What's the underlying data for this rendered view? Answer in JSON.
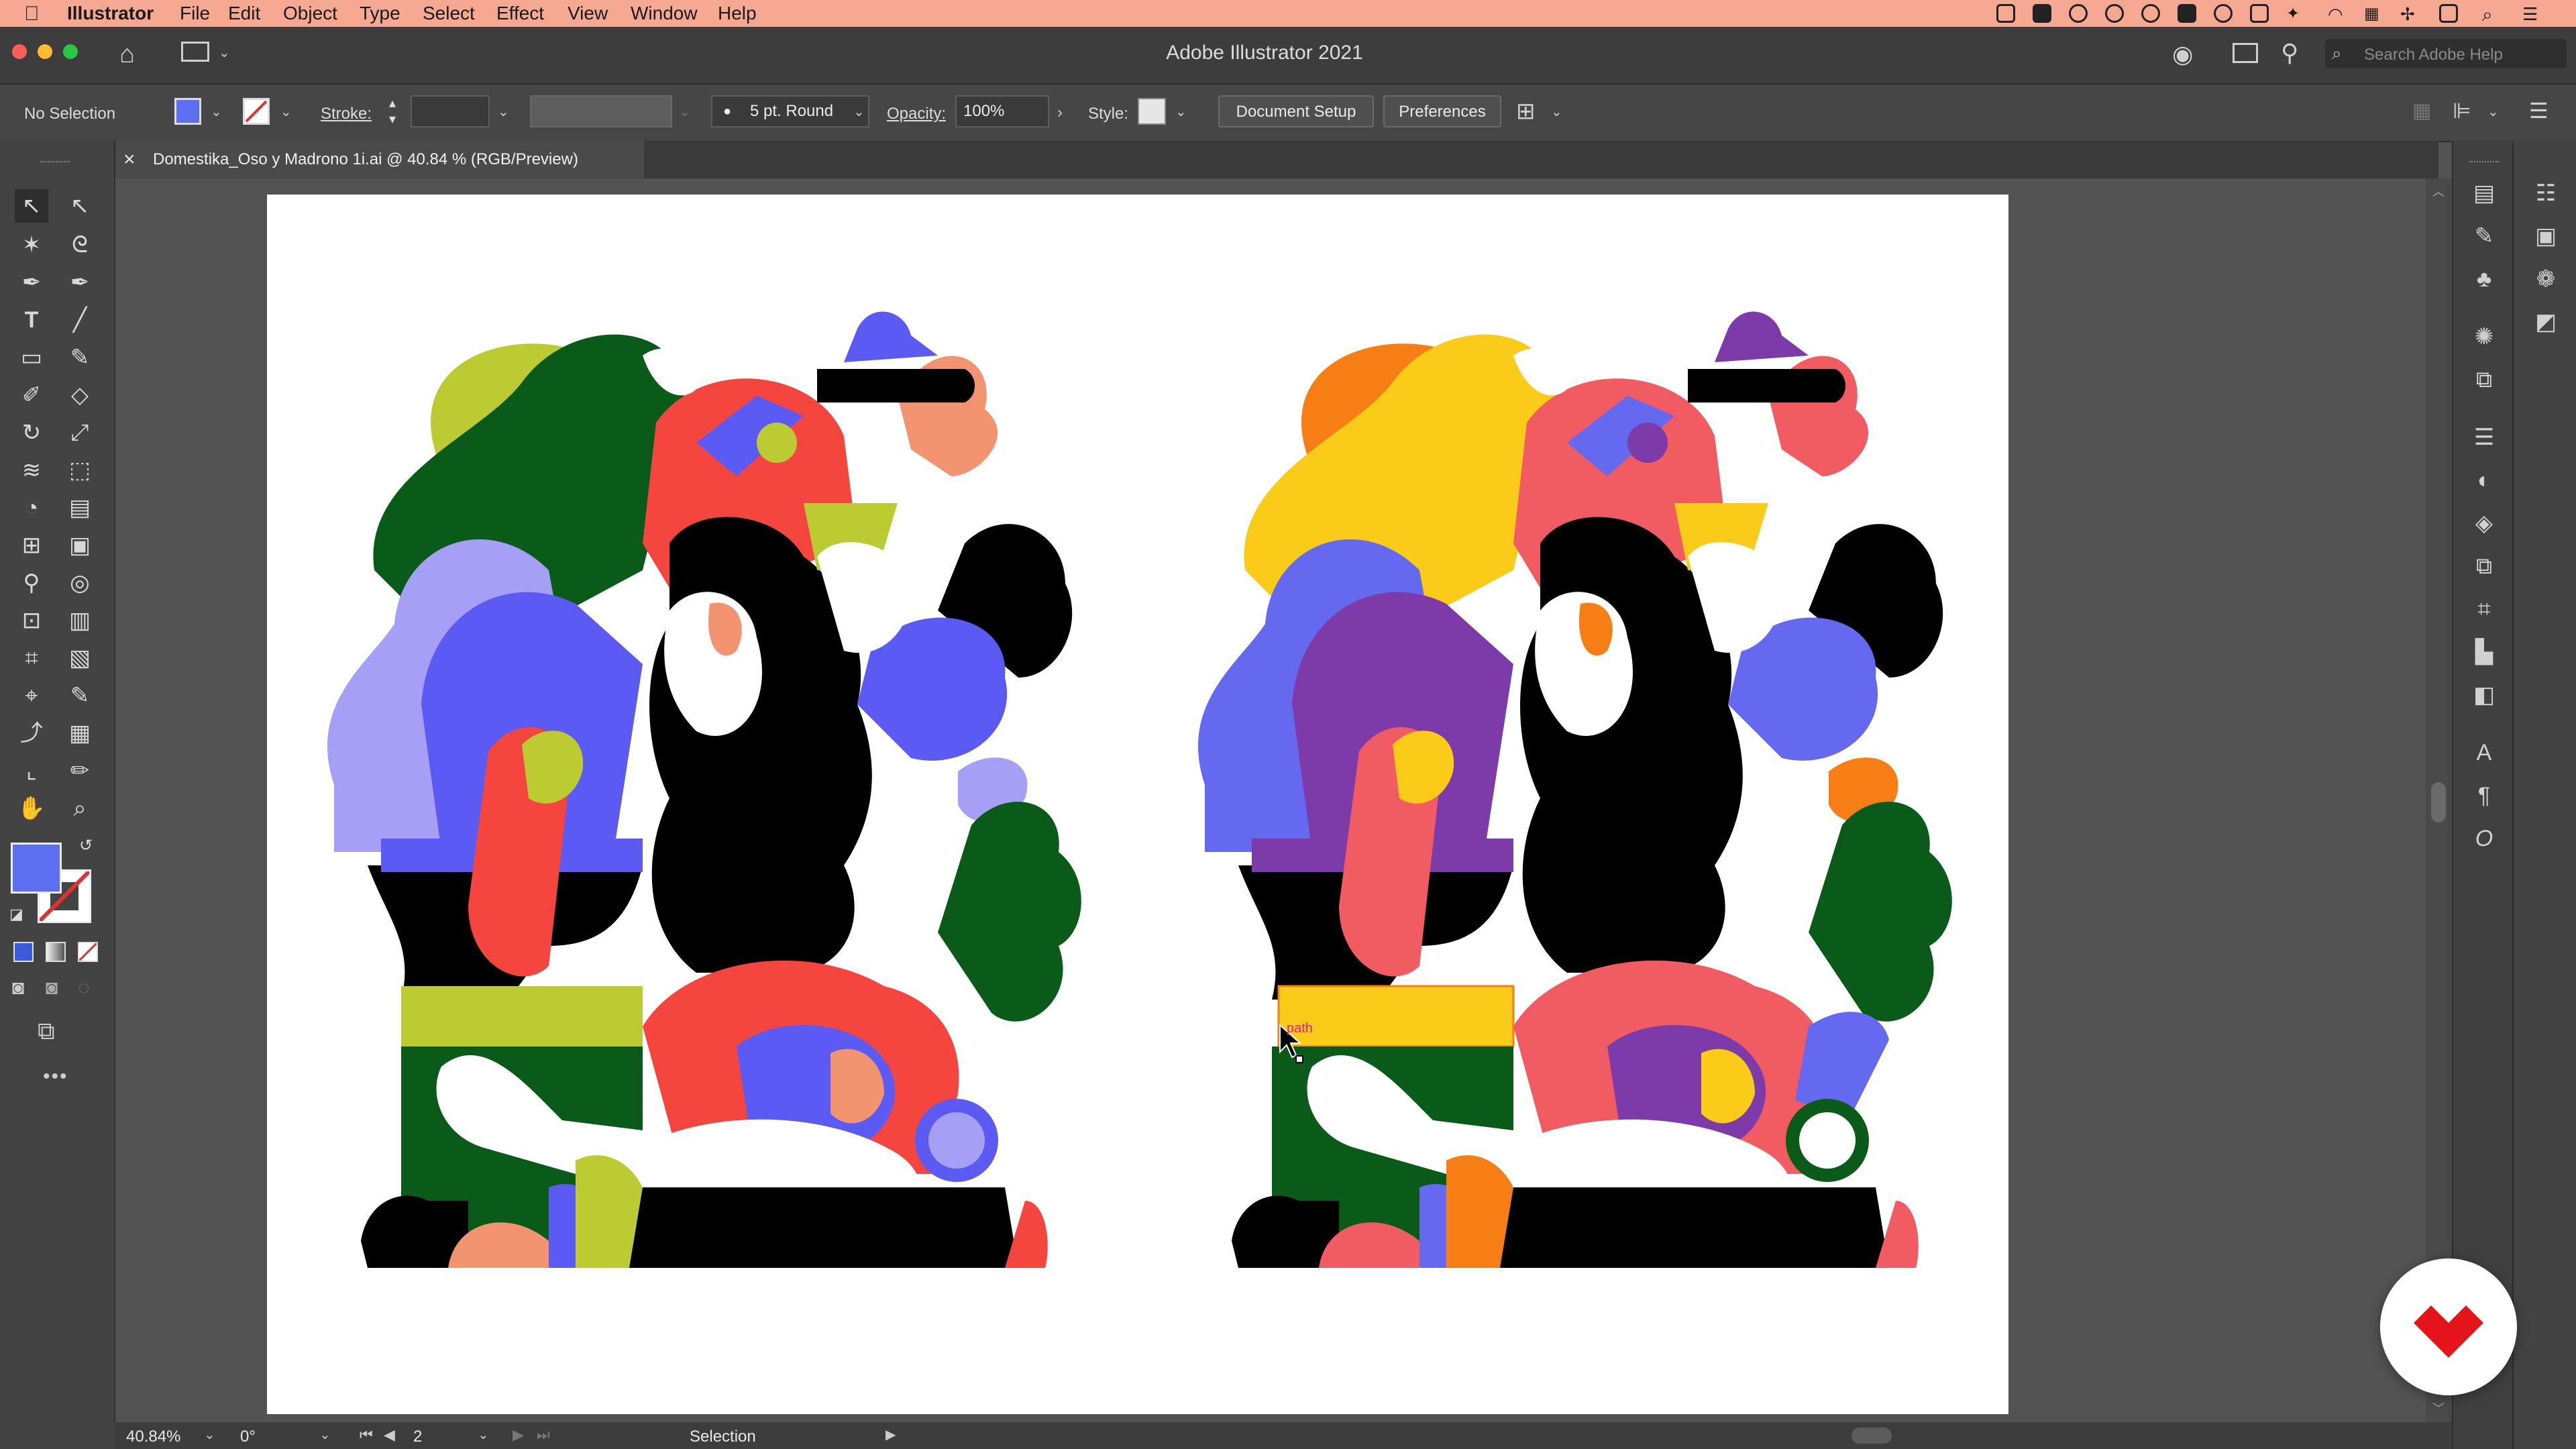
{
  "menubar": {
    "apple": "",
    "app_name": "Illustrator",
    "items": [
      "File",
      "Edit",
      "Object",
      "Type",
      "Select",
      "Effect",
      "View",
      "Window",
      "Help"
    ]
  },
  "window": {
    "title": "Adobe Illustrator 2021",
    "search_placeholder": "Search Adobe Help"
  },
  "control_bar": {
    "selection": "No Selection",
    "stroke_label": "Stroke:",
    "brush": "5 pt. Round",
    "opacity_label": "Opacity:",
    "opacity_value": "100%",
    "style_label": "Style:",
    "document_setup": "Document Setup",
    "preferences": "Preferences"
  },
  "tab": {
    "close": "×",
    "title": "Domestika_Oso y Madrono 1i.ai @ 40.84 % (RGB/Preview)"
  },
  "swatches": [
    "#000000",
    "#f4453f",
    "#0a5a1a",
    "#5b5bf4"
  ],
  "fill_color": "#5b6ff0",
  "canvas": {
    "hover_label": "path"
  },
  "status": {
    "zoom": "40.84%",
    "rotation": "0°",
    "artboard": "2",
    "tool": "Selection"
  },
  "colors": {
    "left_palette": [
      "#bccb31",
      "#0a5a1a",
      "#f4453f",
      "#5b5bf4",
      "#a5a0f6",
      "#000000",
      "#f29470"
    ],
    "right_palette": [
      "#f77e14",
      "#fbcb19",
      "#7d3aa9",
      "#f15c63",
      "#6469ef",
      "#0a5a1a",
      "#000000"
    ]
  }
}
